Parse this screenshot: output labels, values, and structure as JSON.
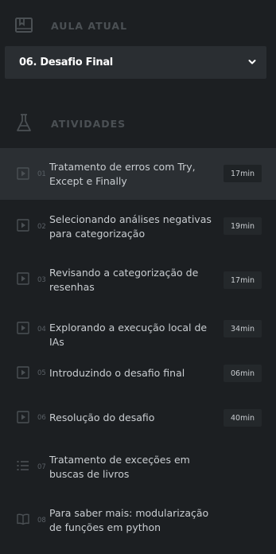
{
  "current_lesson": {
    "header_label": "AULA ATUAL",
    "selected": "06. Desafio Final"
  },
  "activities": {
    "header_label": "ATIVIDADES",
    "items": [
      {
        "number": "01",
        "title": "Tratamento de erros com Try, Except e Finally",
        "duration": "17min",
        "type": "video-icon",
        "active": true
      },
      {
        "number": "02",
        "title": "Selecionando análises negativas para categorização",
        "duration": "19min",
        "type": "video-icon"
      },
      {
        "number": "03",
        "title": "Revisando a categorização de resenhas",
        "duration": "17min",
        "type": "video-icon"
      },
      {
        "number": "04",
        "title": "Explorando a execução local de IAs",
        "duration": "34min",
        "type": "video-icon"
      },
      {
        "number": "05",
        "title": "Introduzindo o desafio final",
        "duration": "06min",
        "type": "video-icon"
      },
      {
        "number": "06",
        "title": "Resolução do desafio",
        "duration": "40min",
        "type": "video-icon"
      },
      {
        "number": "07",
        "title": "Tratamento de exceções em buscas de livros",
        "duration": "",
        "type": "list-icon"
      },
      {
        "number": "08",
        "title": "Para saber mais: modularização de funções em python",
        "duration": "",
        "type": "book-icon"
      }
    ]
  },
  "colors": {
    "background": "#1c1f22",
    "active_row": "#2b2f33",
    "select_bg": "#2a2e32",
    "muted": "#4b5054"
  }
}
